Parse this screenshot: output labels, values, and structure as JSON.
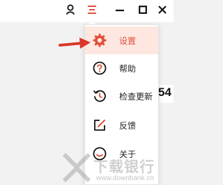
{
  "menu": {
    "items": [
      {
        "label": "设置",
        "icon": "gear-icon"
      },
      {
        "label": "帮助",
        "icon": "help-icon"
      },
      {
        "label": "检查更新",
        "icon": "refresh-icon"
      },
      {
        "label": "反馈",
        "icon": "edit-icon"
      },
      {
        "label": "关于",
        "icon": "about-icon"
      }
    ]
  },
  "content": {
    "number_fragment": "54"
  },
  "watermark": {
    "title": "下载银行",
    "url": "www.downbank.cn"
  },
  "colors": {
    "accent": "#e0503a",
    "highlight_bg": "#fde7e0"
  }
}
